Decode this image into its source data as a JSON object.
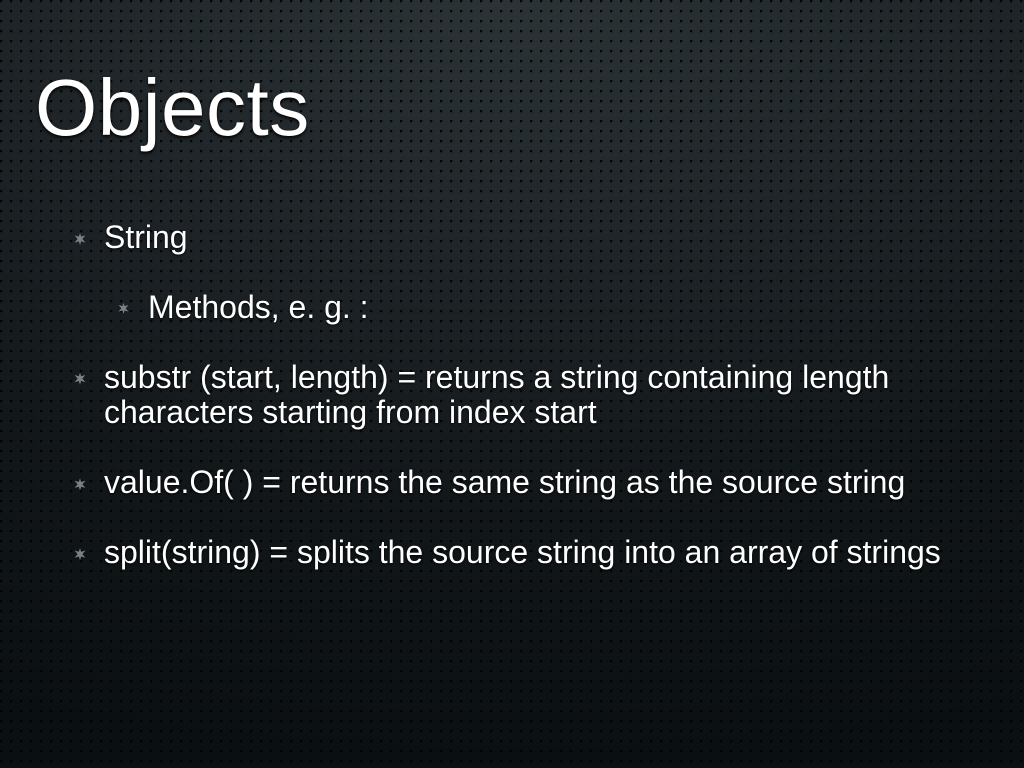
{
  "title": "Objects",
  "items": [
    {
      "text": "String",
      "indent": false
    },
    {
      "text": "Methods, e. g. :",
      "indent": true
    },
    {
      "text": "substr (start, length) = returns a string containing length characters starting from index start",
      "indent": false
    },
    {
      "text": "value.Of( ) = returns the same string as the source string",
      "indent": false
    },
    {
      "text": "split(string) = splits the source string into an array of strings",
      "indent": false
    }
  ]
}
